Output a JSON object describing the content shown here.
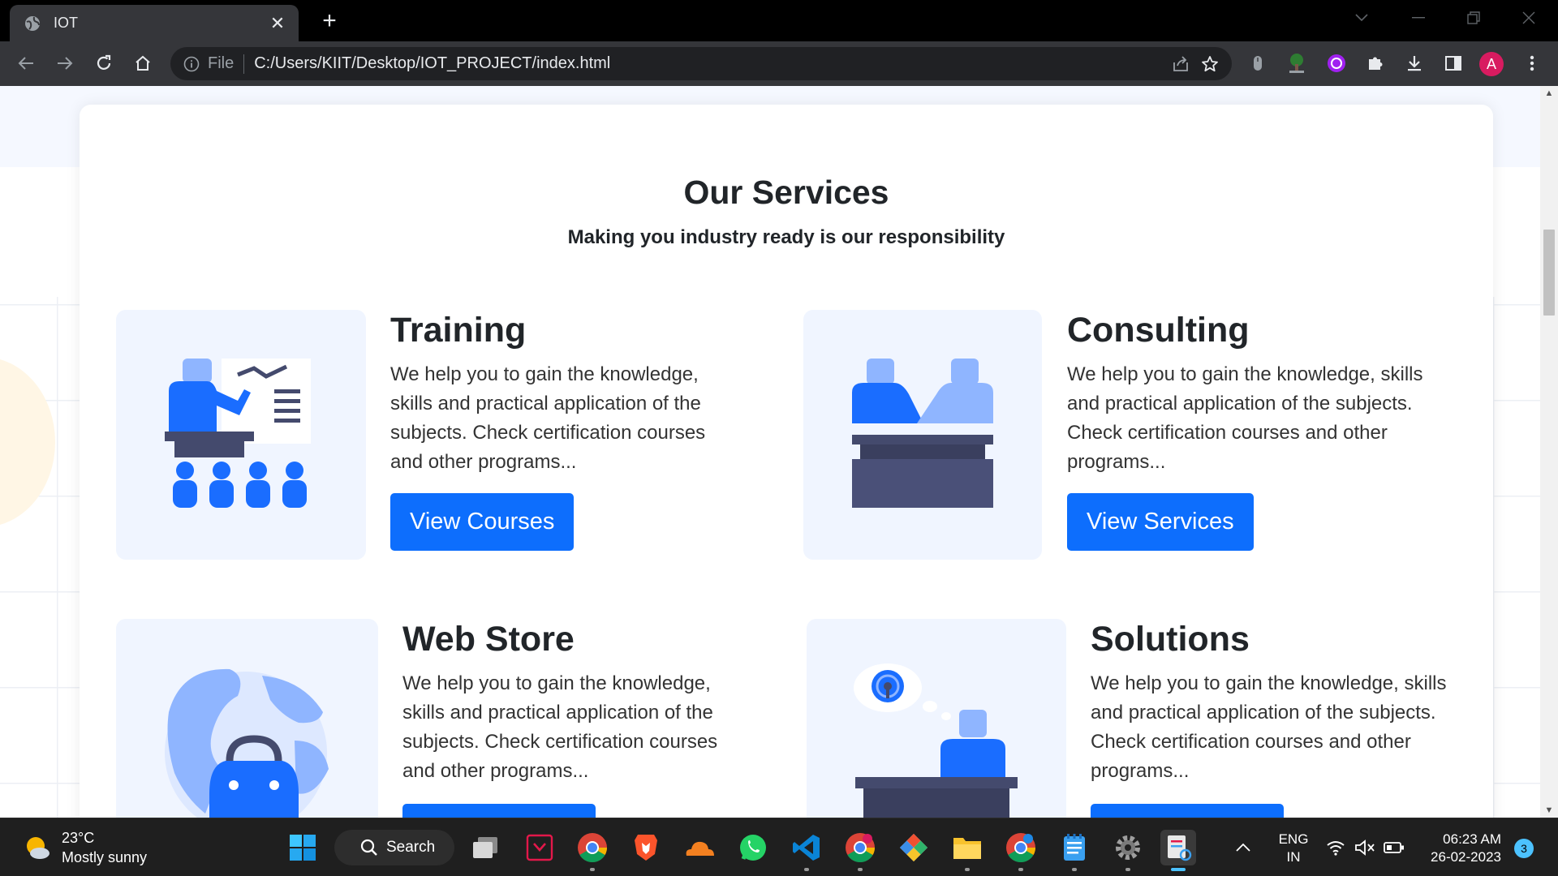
{
  "browser": {
    "tab_title": "IOT",
    "address_scheme": "File",
    "address_url": "C:/Users/KIIT/Desktop/IOT_PROJECT/index.html",
    "profile_initial": "A"
  },
  "page": {
    "section_title": "Our Services",
    "section_subtitle": "Making you industry ready is our responsibility",
    "services": [
      {
        "title": "Training",
        "description": "We help you to gain the knowledge, skills and practical application of the subjects. Check certification courses and other programs...",
        "button_label": "View Courses",
        "icon": "presentation-classroom-illustration"
      },
      {
        "title": "Consulting",
        "description": "We help you to gain the knowledge, skills and practical application of the subjects. Check certification courses and other programs...",
        "button_label": "View Services",
        "icon": "handshake-consulting-illustration"
      },
      {
        "title": "Web Store",
        "description": "We help you to gain the knowledge, skills and practical application of the subjects. Check certification courses and other programs...",
        "icon": "globe-shopping-bag-illustration"
      },
      {
        "title": "Solutions",
        "description": "We help you to gain the knowledge, skills and practical application of the subjects. Check certification courses and other programs...",
        "icon": "idea-thinking-illustration"
      }
    ]
  },
  "taskbar": {
    "weather_temp": "23°C",
    "weather_desc": "Mostly sunny",
    "search_label": "Search",
    "lang_line1": "ENG",
    "lang_line2": "IN",
    "time": "06:23 AM",
    "date": "26-02-2023",
    "notification_count": "3"
  },
  "colors": {
    "accent": "#0d6efd",
    "illustration_blue": "#1a6dff",
    "illustration_navy": "#444a6d",
    "card_bg": "#f0f5ff"
  }
}
